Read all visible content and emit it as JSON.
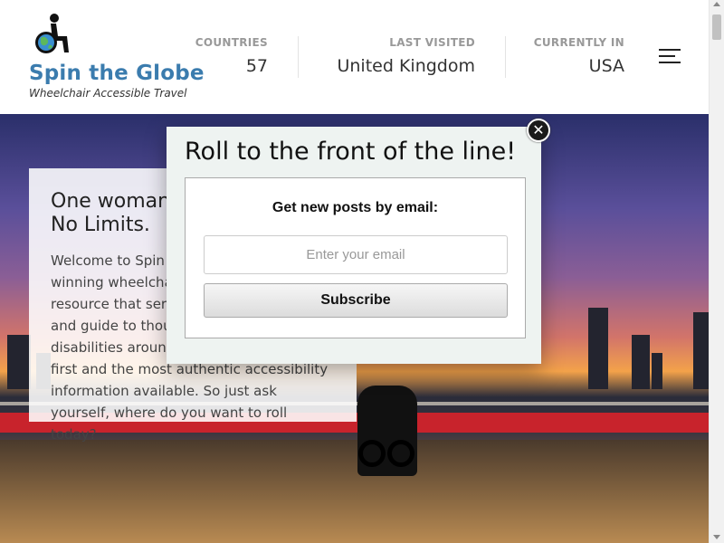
{
  "site": {
    "title": "Spin the Globe",
    "tagline": "Wheelchair Accessible Travel",
    "logo_icon": "wheelchair-globe-icon"
  },
  "stats": [
    {
      "label": "COUNTRIES",
      "value": "57"
    },
    {
      "label": "LAST VISITED",
      "value": "United Kingdom"
    },
    {
      "label": "CURRENTLY IN",
      "value": "USA"
    }
  ],
  "menu": {
    "icon": "hamburger-menu-icon"
  },
  "hero": {
    "title": "One woman… No Limits.",
    "title_line1": "One woman",
    "title_line2": "No Limits.",
    "text": "Welcome to Spin the Globe, an award-winning wheelchair travel blog and resource that serves as an inspiration and guide to thousands of readers with disabilities around the world, usually the first and the most authentic accessibility information available. So just ask yourself, where do you want to roll today?"
  },
  "popup": {
    "title": "Roll to the front of the line!",
    "label": "Get new posts by email:",
    "email_placeholder": "Enter your email",
    "button_label": "Subscribe",
    "close_label": "✕"
  },
  "colors": {
    "brand": "#3b7cae",
    "rail": "#c8232c",
    "popup_bg": "#eef3f1"
  }
}
